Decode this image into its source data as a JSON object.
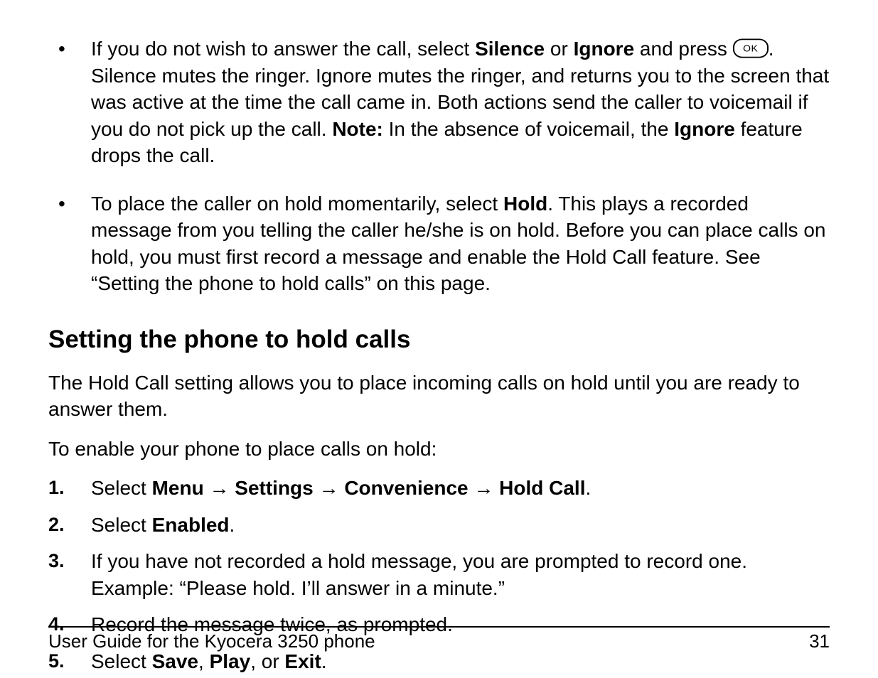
{
  "bullets": [
    {
      "pre": "If you do not wish to answer the call, select ",
      "bold1": "Silence",
      "mid1": " or ",
      "bold2": "Ignore",
      "mid2": " and press ",
      "ok_label": "OK",
      "mid3": ". Silence mutes the ringer. Ignore mutes the ringer, and returns you to the screen that was active at the time the call came in. Both actions send the caller to voicemail if you do not pick up the call. ",
      "note_label": "Note:",
      "mid4": " In the absence of voicemail, the ",
      "bold3": "Ignore",
      "post": " feature drops the call."
    },
    {
      "pre": "To place the caller on hold momentarily, select ",
      "bold1": "Hold",
      "post": ". This plays a recorded message from you telling the caller he/she is on hold. Before you can place calls on hold, you must first record a message and enable the Hold Call feature. See “Setting the phone to hold calls” on this page."
    }
  ],
  "heading": "Setting the phone to hold calls",
  "para1": "The Hold Call setting allows you to place incoming calls on hold until you are ready to answer them.",
  "para2": "To enable your phone to place calls on hold:",
  "steps": [
    {
      "n": "1.",
      "pre": "Select ",
      "segs": [
        {
          "b": "Menu"
        },
        {
          "t": " → "
        },
        {
          "b": "Settings"
        },
        {
          "t": " → "
        },
        {
          "b": "Convenience"
        },
        {
          "t": " → "
        },
        {
          "b": "Hold Call"
        },
        {
          "t": "."
        }
      ]
    },
    {
      "n": "2.",
      "pre": "Select ",
      "segs": [
        {
          "b": "Enabled"
        },
        {
          "t": "."
        }
      ]
    },
    {
      "n": "3.",
      "pre": "If you have not recorded a hold message, you are prompted to record one. Example: “Please hold. I’ll answer in a minute.”",
      "segs": []
    },
    {
      "n": "4.",
      "pre": "Record the message twice, as prompted.",
      "segs": []
    },
    {
      "n": "5.",
      "pre": "Select ",
      "segs": [
        {
          "b": "Save"
        },
        {
          "t": ", "
        },
        {
          "b": "Play"
        },
        {
          "t": ", or "
        },
        {
          "b": "Exit"
        },
        {
          "t": "."
        }
      ]
    }
  ],
  "footer_left": "User Guide for the Kyocera 3250 phone",
  "footer_right": "31"
}
